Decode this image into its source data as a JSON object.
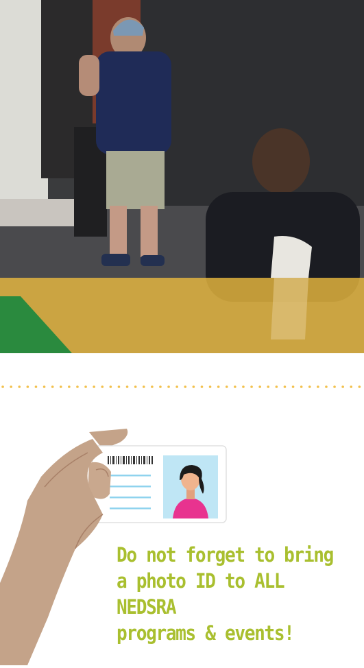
{
  "colors": {
    "accent_text": "#a9bf2f",
    "dots": "#f2c14e",
    "band_gold": "#c9a03a",
    "triangle_green": "#2a8a3e",
    "card_photo_bg": "#bfe6f5",
    "card_person_shirt": "#e8338f"
  },
  "hero": {
    "image_description_icon": "photo-of-person-speaking"
  },
  "reminder": {
    "line1": "Do not forget to bring",
    "line2": "a photo ID to ALL NEDSRA",
    "line3": "programs & events!"
  }
}
